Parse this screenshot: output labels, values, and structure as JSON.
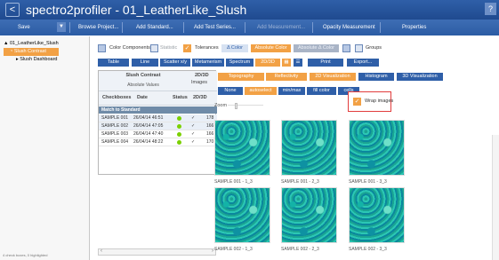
{
  "window": {
    "back_glyph": "<",
    "title": "spectro2profiler - 01_LeatherLike_Slush",
    "help_glyph": "?"
  },
  "menu": {
    "save": "Save",
    "dropdown_glyph": "▼",
    "browse_project": "Browse Project...",
    "add_standard": "Add Standard...",
    "add_test_series": "Add Test Series...",
    "add_measurement": "Add Measurement...",
    "opacity_measurement": "Opacity Measurement",
    "properties": "Properties"
  },
  "tree": {
    "root": "01_LeatherLike_Slush",
    "contrast": "Slush Contrast",
    "dashboard": "Slush Dashboard"
  },
  "left_footer": "4 check boxes, 0 highlighted",
  "toolbar": {
    "color_components": "Color Components",
    "statistic": "Statistic",
    "tolerances": "Tolerances",
    "dcolor": "Δ Color",
    "absolute_color": "Absolute Color",
    "absolute_dcolor": "Absolute Δ Color",
    "groups": "Groups",
    "table": "Table",
    "line": "Line",
    "scatter": "Scatter x/y",
    "metamerism": "Metamerism",
    "spectrum": "Spectrum",
    "twoD3D": "2D/3D",
    "print": "Print",
    "export": "Export..."
  },
  "table": {
    "group_title": "Slush Contrast",
    "group_sub": "Absolute Values",
    "images_head": "2D/3D",
    "images_label": "Images",
    "checkboxes": "Checkboxes",
    "date": "Date",
    "status": "Status",
    "match": "Match to Standard",
    "rows": [
      {
        "name": "SAMPLE 001",
        "date": "26/04/14 46:51",
        "check": "✓",
        "value": "178"
      },
      {
        "name": "SAMPLE 002",
        "date": "26/04/14 47:05",
        "check": "✓",
        "value": "166"
      },
      {
        "name": "SAMPLE 003",
        "date": "26/04/14 47:40",
        "check": "✓",
        "value": "166"
      },
      {
        "name": "SAMPLE 004",
        "date": "26/04/14 48:22",
        "check": "✓",
        "value": "170"
      }
    ]
  },
  "view": {
    "topography": "Topography",
    "reflectivity": "Reflectivity",
    "viz2d": "2D Visualization",
    "histogram": "Histogram",
    "viz3d": "3D Visualization",
    "none": "None",
    "autoselect": "autoselect",
    "minmax": "min/max",
    "fillcolor": "fill color",
    "cells": "cells",
    "zoom": "Zoom",
    "wrap_images": "Wrap images",
    "tiles": [
      {
        "label": "SAMPLE 001 - 1_3"
      },
      {
        "label": "SAMPLE 001 - 2_3"
      },
      {
        "label": "SAMPLE 001 - 3_3"
      },
      {
        "label": "SAMPLE 002 - 1_3"
      },
      {
        "label": "SAMPLE 002 - 2_3"
      },
      {
        "label": "SAMPLE 002 - 3_3"
      }
    ]
  }
}
